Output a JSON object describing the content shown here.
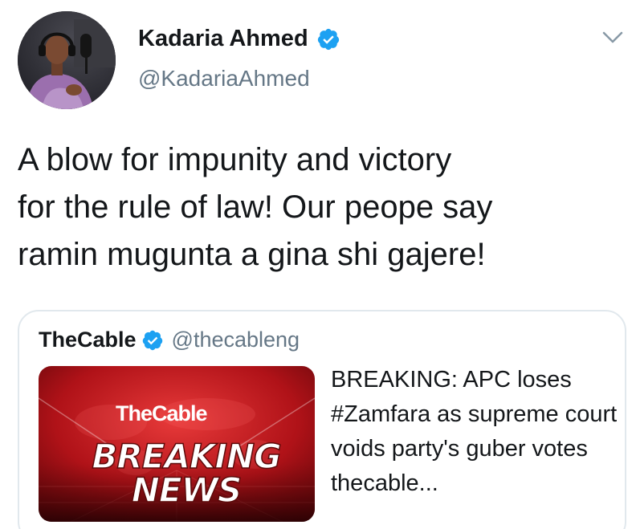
{
  "tweet": {
    "author": {
      "name": "Kadaria Ahmed",
      "handle": "@KadariaAhmed",
      "verified": true,
      "avatar_icon": "profile-photo-avatar"
    },
    "text": "A blow for impunity and victory\nfor the rule of law!  Our peope say\nramin mugunta a gina shi gajere!",
    "menu_icon": "chevron-down-icon",
    "quoted_tweet": {
      "author_name": "TheCable",
      "author_handle": "@thecableng",
      "verified": true,
      "text": "BREAKING: APC loses #Zamfara as supreme court voids party's guber votes thecable...",
      "media": {
        "brand": "TheCable",
        "headline_line1": "BREAKING",
        "headline_line2": "NEWS"
      }
    }
  },
  "colors": {
    "verified_blue": "#1da1f2",
    "secondary_text": "#657786",
    "border": "#e1e8ed",
    "breaking_red": "#c4161c"
  }
}
